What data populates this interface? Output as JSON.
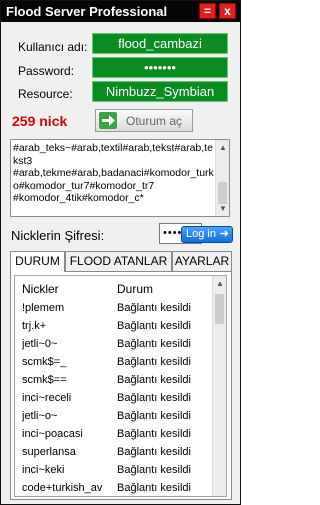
{
  "window": {
    "title": "Flood Server Professional",
    "minimize": "=",
    "close": "x"
  },
  "form": {
    "username_label": "Kullanıcı adı:",
    "username_value": "flood_cambazi",
    "password_label": "Password:",
    "password_value": "•••••••",
    "resource_label": "Resource:",
    "resource_value": "Nimbuzz_Symbian"
  },
  "nick_count": "259 nick",
  "login_button": "Oturum aç",
  "rooms_text": "#arab_teks~#arab,textil#arab,tekst#arab,tekst3\n#arab,tekme#arab,badanaci#komodor_turko#komodor_tur7#komodor_tr7\n#komodor_4tik#komodor_c*",
  "nick_password": {
    "label": "Nicklerin Şifresi:",
    "value": "•••••••",
    "button": "Log in"
  },
  "tabs": [
    "DURUM",
    "FLOOD ATANLAR",
    "AYARLAR"
  ],
  "list": {
    "headers": [
      "Nickler",
      "Durum"
    ],
    "rows": [
      [
        "!plemem",
        "Bağlantı kesildi"
      ],
      [
        "trj.k+",
        "Bağlantı kesildi"
      ],
      [
        "jetli~0~",
        "Bağlantı kesildi"
      ],
      [
        "scmk$=_",
        "Bağlantı kesildi"
      ],
      [
        "scmk$==",
        "Bağlantı kesildi"
      ],
      [
        "inci~receli",
        "Bağlantı kesildi"
      ],
      [
        "jetli~o~",
        "Bağlantı kesildi"
      ],
      [
        "inci~poacasi",
        "Bağlantı kesildi"
      ],
      [
        "superlansa",
        "Bağlantı kesildi"
      ],
      [
        "inci~keki",
        "Bağlantı kesildi"
      ],
      [
        "code+turkish_av",
        "Bağlantı kesildi"
      ]
    ]
  }
}
